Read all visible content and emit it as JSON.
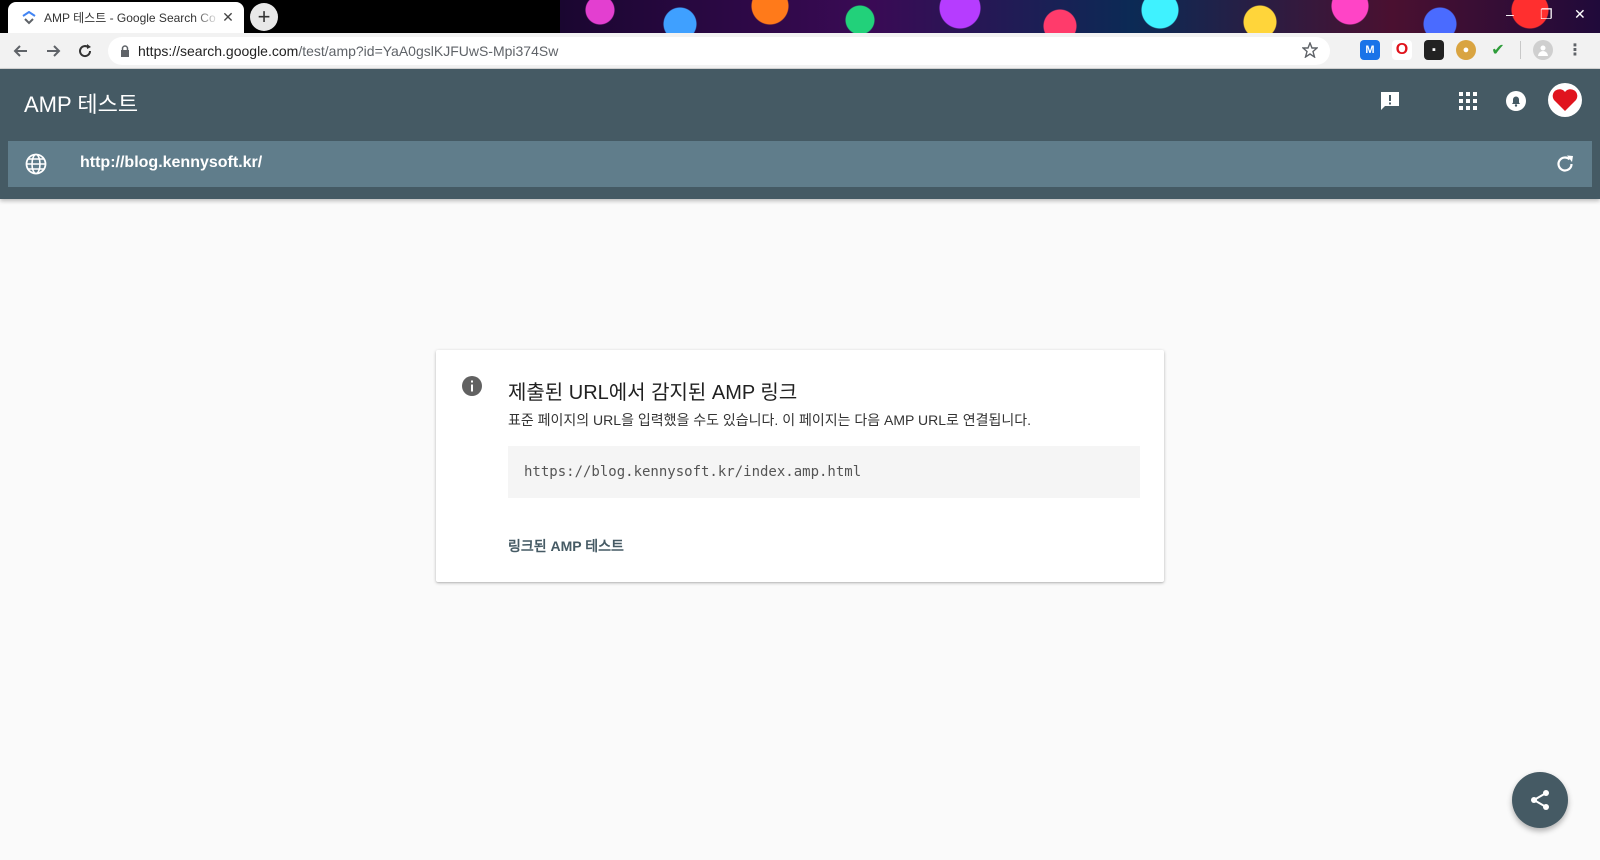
{
  "browser": {
    "tab_title": "AMP 테스트 - Google Search Co",
    "new_tab_label": "+",
    "url_scheme_host": "https://search.google.com",
    "url_path": "/test/amp?id=YaA0gslKJFUwS-Mpi374Sw",
    "window_controls": [
      "–",
      "❐",
      "✕"
    ],
    "extensions": [
      {
        "name": "mailtrack-icon",
        "color": "#1a73e8",
        "glyph": "M"
      },
      {
        "name": "opera-icon",
        "color": "#e0121b",
        "glyph": "O"
      },
      {
        "name": "tampermonkey-icon",
        "color": "#222222",
        "glyph": "▪"
      },
      {
        "name": "cookie-icon",
        "color": "#d9a441",
        "glyph": "●"
      },
      {
        "name": "checkmark-icon",
        "color": "#2e9d3a",
        "glyph": "✔"
      }
    ]
  },
  "header": {
    "title": "AMP 테스트",
    "tested_url": "http://blog.kennysoft.kr/"
  },
  "card": {
    "title": "제출된 URL에서 감지된 AMP 링크",
    "description": "표준 페이지의 URL을 입력했을 수도 있습니다. 이 페이지는 다음 AMP URL로 연결됩니다.",
    "amp_url": "https://blog.kennysoft.kr/index.amp.html",
    "link_label": "링크된 AMP 테스트"
  },
  "colors": {
    "header": "#455a64",
    "url_bar": "#607d8b",
    "background": "#fafafa",
    "avatar_heart": "#e0141e"
  }
}
